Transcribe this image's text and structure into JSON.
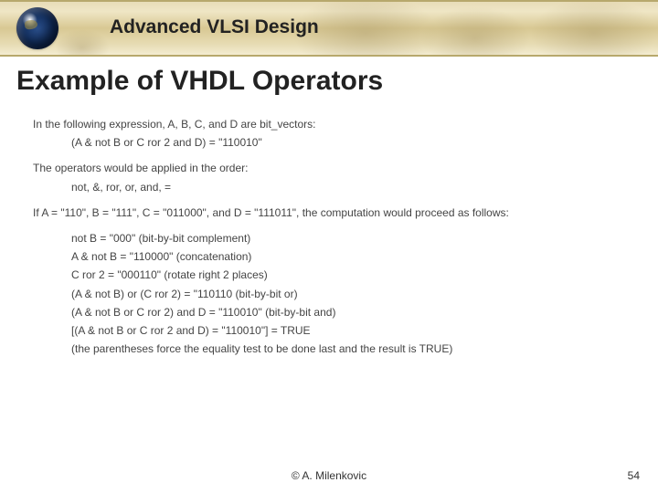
{
  "header": {
    "course": "Advanced VLSI Design"
  },
  "title": "Example of VHDL Operators",
  "body": {
    "intro": "In the following expression, A, B, C, and D are bit_vectors:",
    "expr": "(A & not B or C ror 2 and D)   =   \"110010\"",
    "order_label": "The operators would be applied in the order:",
    "order": "not, &, ror, or, and, =",
    "given": "If  A = \"110\", B = \"111\", C = \"011000\", and D = \"111011\", the computation would proceed as follows:",
    "steps": [
      "not B = \"000\"   (bit-by-bit complement)",
      "A & not B = \"110000\"    (concatenation)",
      "C ror 2 = \"000110\"    (rotate right 2 places)",
      "(A & not B) or (C ror 2) = \"110110    (bit-by-bit or)",
      "(A & not B or C ror 2) and D = \"110010\"  (bit-by-bit and)",
      "[(A & not B or C ror 2 and D) = \"110010\"] = TRUE",
      "(the parentheses force the equality test to be done last and the result is TRUE)"
    ]
  },
  "footer": {
    "author": "©  A. Milenkovic",
    "page": "54"
  }
}
